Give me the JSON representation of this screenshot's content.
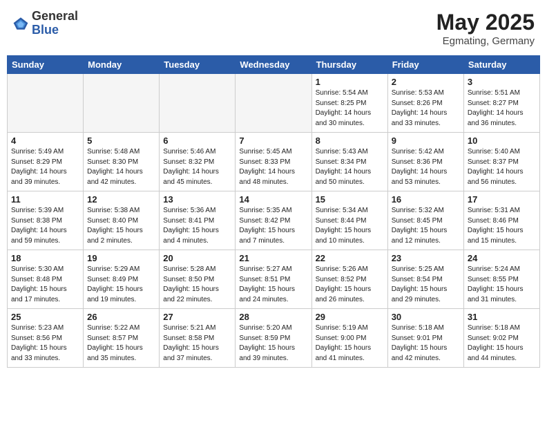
{
  "header": {
    "logo_general": "General",
    "logo_blue": "Blue",
    "month_title": "May 2025",
    "location": "Egmating, Germany"
  },
  "days_of_week": [
    "Sunday",
    "Monday",
    "Tuesday",
    "Wednesday",
    "Thursday",
    "Friday",
    "Saturday"
  ],
  "weeks": [
    [
      {
        "day": "",
        "empty": true
      },
      {
        "day": "",
        "empty": true
      },
      {
        "day": "",
        "empty": true
      },
      {
        "day": "",
        "empty": true
      },
      {
        "day": "1",
        "sunrise": "5:54 AM",
        "sunset": "8:25 PM",
        "daylight": "14 hours and 30 minutes."
      },
      {
        "day": "2",
        "sunrise": "5:53 AM",
        "sunset": "8:26 PM",
        "daylight": "14 hours and 33 minutes."
      },
      {
        "day": "3",
        "sunrise": "5:51 AM",
        "sunset": "8:27 PM",
        "daylight": "14 hours and 36 minutes."
      }
    ],
    [
      {
        "day": "4",
        "sunrise": "5:49 AM",
        "sunset": "8:29 PM",
        "daylight": "14 hours and 39 minutes."
      },
      {
        "day": "5",
        "sunrise": "5:48 AM",
        "sunset": "8:30 PM",
        "daylight": "14 hours and 42 minutes."
      },
      {
        "day": "6",
        "sunrise": "5:46 AM",
        "sunset": "8:32 PM",
        "daylight": "14 hours and 45 minutes."
      },
      {
        "day": "7",
        "sunrise": "5:45 AM",
        "sunset": "8:33 PM",
        "daylight": "14 hours and 48 minutes."
      },
      {
        "day": "8",
        "sunrise": "5:43 AM",
        "sunset": "8:34 PM",
        "daylight": "14 hours and 50 minutes."
      },
      {
        "day": "9",
        "sunrise": "5:42 AM",
        "sunset": "8:36 PM",
        "daylight": "14 hours and 53 minutes."
      },
      {
        "day": "10",
        "sunrise": "5:40 AM",
        "sunset": "8:37 PM",
        "daylight": "14 hours and 56 minutes."
      }
    ],
    [
      {
        "day": "11",
        "sunrise": "5:39 AM",
        "sunset": "8:38 PM",
        "daylight": "14 hours and 59 minutes."
      },
      {
        "day": "12",
        "sunrise": "5:38 AM",
        "sunset": "8:40 PM",
        "daylight": "15 hours and 2 minutes."
      },
      {
        "day": "13",
        "sunrise": "5:36 AM",
        "sunset": "8:41 PM",
        "daylight": "15 hours and 4 minutes."
      },
      {
        "day": "14",
        "sunrise": "5:35 AM",
        "sunset": "8:42 PM",
        "daylight": "15 hours and 7 minutes."
      },
      {
        "day": "15",
        "sunrise": "5:34 AM",
        "sunset": "8:44 PM",
        "daylight": "15 hours and 10 minutes."
      },
      {
        "day": "16",
        "sunrise": "5:32 AM",
        "sunset": "8:45 PM",
        "daylight": "15 hours and 12 minutes."
      },
      {
        "day": "17",
        "sunrise": "5:31 AM",
        "sunset": "8:46 PM",
        "daylight": "15 hours and 15 minutes."
      }
    ],
    [
      {
        "day": "18",
        "sunrise": "5:30 AM",
        "sunset": "8:48 PM",
        "daylight": "15 hours and 17 minutes."
      },
      {
        "day": "19",
        "sunrise": "5:29 AM",
        "sunset": "8:49 PM",
        "daylight": "15 hours and 19 minutes."
      },
      {
        "day": "20",
        "sunrise": "5:28 AM",
        "sunset": "8:50 PM",
        "daylight": "15 hours and 22 minutes."
      },
      {
        "day": "21",
        "sunrise": "5:27 AM",
        "sunset": "8:51 PM",
        "daylight": "15 hours and 24 minutes."
      },
      {
        "day": "22",
        "sunrise": "5:26 AM",
        "sunset": "8:52 PM",
        "daylight": "15 hours and 26 minutes."
      },
      {
        "day": "23",
        "sunrise": "5:25 AM",
        "sunset": "8:54 PM",
        "daylight": "15 hours and 29 minutes."
      },
      {
        "day": "24",
        "sunrise": "5:24 AM",
        "sunset": "8:55 PM",
        "daylight": "15 hours and 31 minutes."
      }
    ],
    [
      {
        "day": "25",
        "sunrise": "5:23 AM",
        "sunset": "8:56 PM",
        "daylight": "15 hours and 33 minutes."
      },
      {
        "day": "26",
        "sunrise": "5:22 AM",
        "sunset": "8:57 PM",
        "daylight": "15 hours and 35 minutes."
      },
      {
        "day": "27",
        "sunrise": "5:21 AM",
        "sunset": "8:58 PM",
        "daylight": "15 hours and 37 minutes."
      },
      {
        "day": "28",
        "sunrise": "5:20 AM",
        "sunset": "8:59 PM",
        "daylight": "15 hours and 39 minutes."
      },
      {
        "day": "29",
        "sunrise": "5:19 AM",
        "sunset": "9:00 PM",
        "daylight": "15 hours and 41 minutes."
      },
      {
        "day": "30",
        "sunrise": "5:18 AM",
        "sunset": "9:01 PM",
        "daylight": "15 hours and 42 minutes."
      },
      {
        "day": "31",
        "sunrise": "5:18 AM",
        "sunset": "9:02 PM",
        "daylight": "15 hours and 44 minutes."
      }
    ]
  ]
}
